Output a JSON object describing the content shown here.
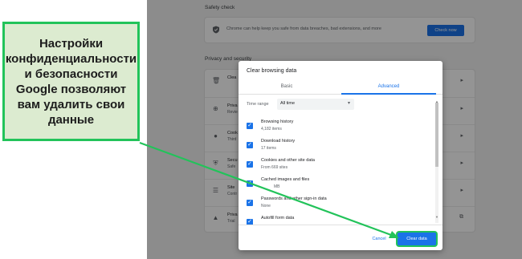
{
  "settings": {
    "safety_check": {
      "title": "Safety check",
      "description": "Chrome can help keep you safe from data breaches, bad extensions, and more",
      "button": "Check now"
    },
    "privacy_section_title": "Privacy and security",
    "privacy_rows": [
      {
        "title": "Clea",
        "subtitle": "",
        "icon": "trash-icon"
      },
      {
        "title": "Priva",
        "subtitle": "Revie",
        "icon": "plus-circle-icon"
      },
      {
        "title": "Cook",
        "subtitle": "Third",
        "icon": "cookie-icon"
      },
      {
        "title": "Secu",
        "subtitle": "Safe",
        "icon": "shield-icon"
      },
      {
        "title": "Site",
        "subtitle": "Contr",
        "icon": "sliders-icon"
      },
      {
        "title": "Priva",
        "subtitle": "Trial",
        "icon": "flask-icon"
      }
    ]
  },
  "dialog": {
    "title": "Clear browsing data",
    "tabs": [
      {
        "label": "Basic",
        "active": false
      },
      {
        "label": "Advanced",
        "active": true
      }
    ],
    "time_range": {
      "label": "Time range",
      "value": "All time"
    },
    "items": [
      {
        "label": "Browsing history",
        "detail": "4,182 items",
        "checked": true
      },
      {
        "label": "Download history",
        "detail": "17 items",
        "checked": true
      },
      {
        "label": "Cookies and other site data",
        "detail": "From 669 sites",
        "checked": true
      },
      {
        "label": "Cached images and files",
        "detail": "MB",
        "checked": true
      },
      {
        "label": "Passwords and other sign-in data",
        "detail": "None",
        "checked": true
      },
      {
        "label": "Autofill form data",
        "detail": "",
        "checked": true
      }
    ],
    "cancel": "Cancel",
    "clear": "Clear data"
  },
  "annotation": {
    "text": "Настройки конфиденциальности и безопасности Google позволяют вам удалить свои данные",
    "color": "#22c35a"
  }
}
